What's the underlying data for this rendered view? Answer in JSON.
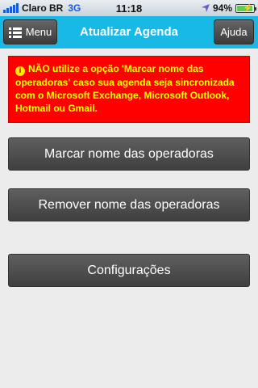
{
  "status_bar": {
    "carrier": "Claro BR",
    "network": "3G",
    "time": "11:18",
    "battery_text": "94%",
    "battery_level": 0.94,
    "icons": [
      "signal-bars-icon",
      "location-arrow-icon",
      "battery-charging-icon"
    ]
  },
  "nav": {
    "menu_label": "Menu",
    "title": "Atualizar Agenda",
    "help_label": "Ajuda"
  },
  "warning": {
    "icon": "info-icon",
    "text": "NÃO utilize a opção 'Marcar nome das operadoras' caso sua agenda seja sincronizada com o Microsoft Exchange, Microsoft Outlook, Hotmail ou Gmail."
  },
  "actions": {
    "mark_label": "Marcar nome das operadoras",
    "remove_label": "Remover nome das operadoras",
    "settings_label": "Configurações"
  },
  "colors": {
    "nav_bg": "#19b9e6",
    "warning_bg": "#ff0000",
    "warning_text": "#ffff00",
    "button_bg": "#4a4a4a",
    "page_bg": "#ececec"
  }
}
